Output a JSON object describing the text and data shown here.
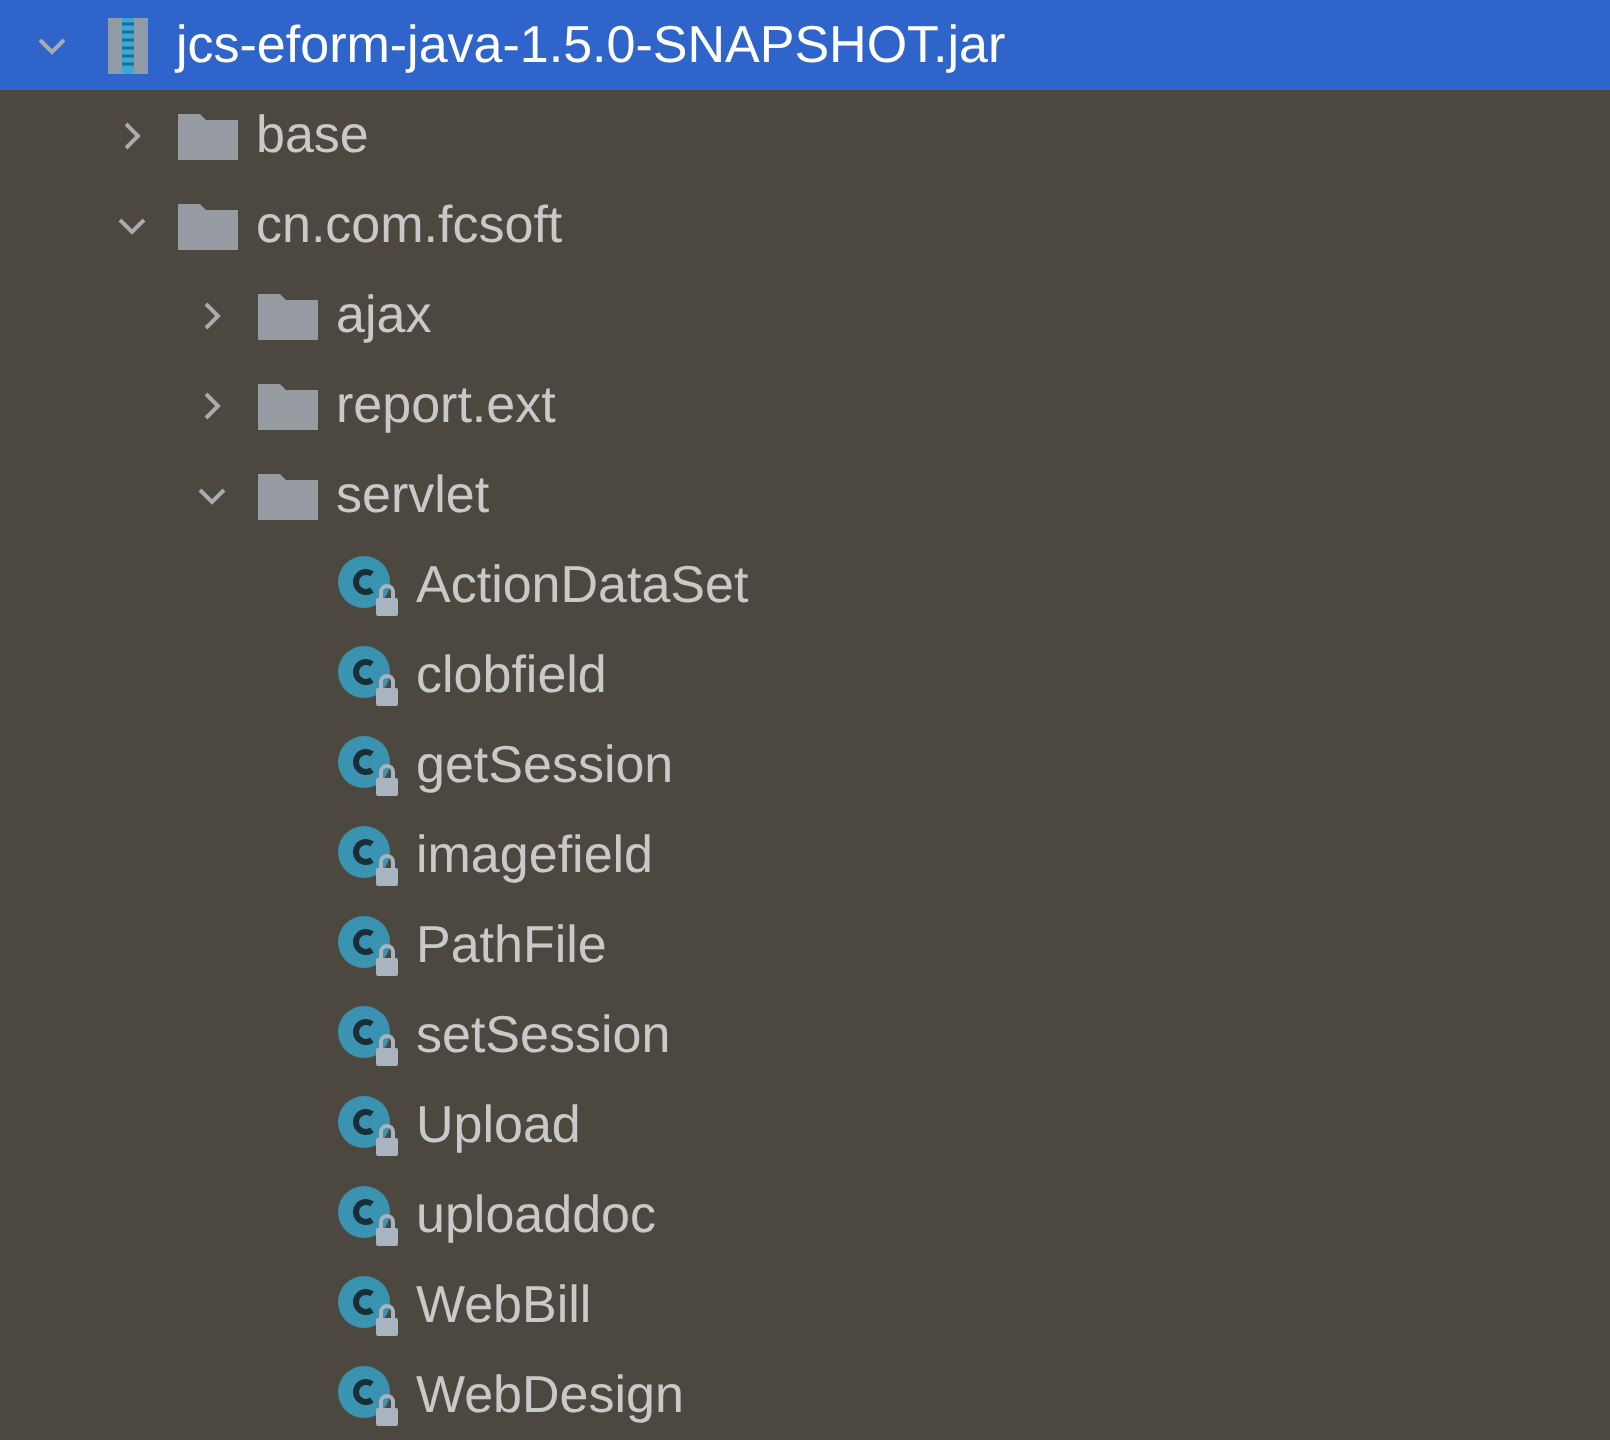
{
  "tree": [
    {
      "label": "jcs-eform-java-1.5.0-SNAPSHOT.jar",
      "kind": "jar",
      "selected": true,
      "expanded": true,
      "children": [
        {
          "label": "base",
          "kind": "package",
          "selected": false,
          "expanded": false
        },
        {
          "label": "cn.com.fcsoft",
          "kind": "package",
          "selected": false,
          "expanded": true,
          "children": [
            {
              "label": "ajax",
              "kind": "package",
              "selected": false,
              "expanded": false
            },
            {
              "label": "report.ext",
              "kind": "package",
              "selected": false,
              "expanded": false
            },
            {
              "label": "servlet",
              "kind": "package",
              "selected": false,
              "expanded": true,
              "children": [
                {
                  "label": "ActionDataSet",
                  "kind": "class",
                  "selected": false
                },
                {
                  "label": "clobfield",
                  "kind": "class",
                  "selected": false
                },
                {
                  "label": "getSession",
                  "kind": "class",
                  "selected": false
                },
                {
                  "label": "imagefield",
                  "kind": "class",
                  "selected": false
                },
                {
                  "label": "PathFile",
                  "kind": "class",
                  "selected": false
                },
                {
                  "label": "setSession",
                  "kind": "class",
                  "selected": false
                },
                {
                  "label": "Upload",
                  "kind": "class",
                  "selected": false
                },
                {
                  "label": "uploaddoc",
                  "kind": "class",
                  "selected": false
                },
                {
                  "label": "WebBill",
                  "kind": "class",
                  "selected": false
                },
                {
                  "label": "WebDesign",
                  "kind": "class",
                  "selected": false
                }
              ]
            }
          ]
        }
      ]
    }
  ]
}
